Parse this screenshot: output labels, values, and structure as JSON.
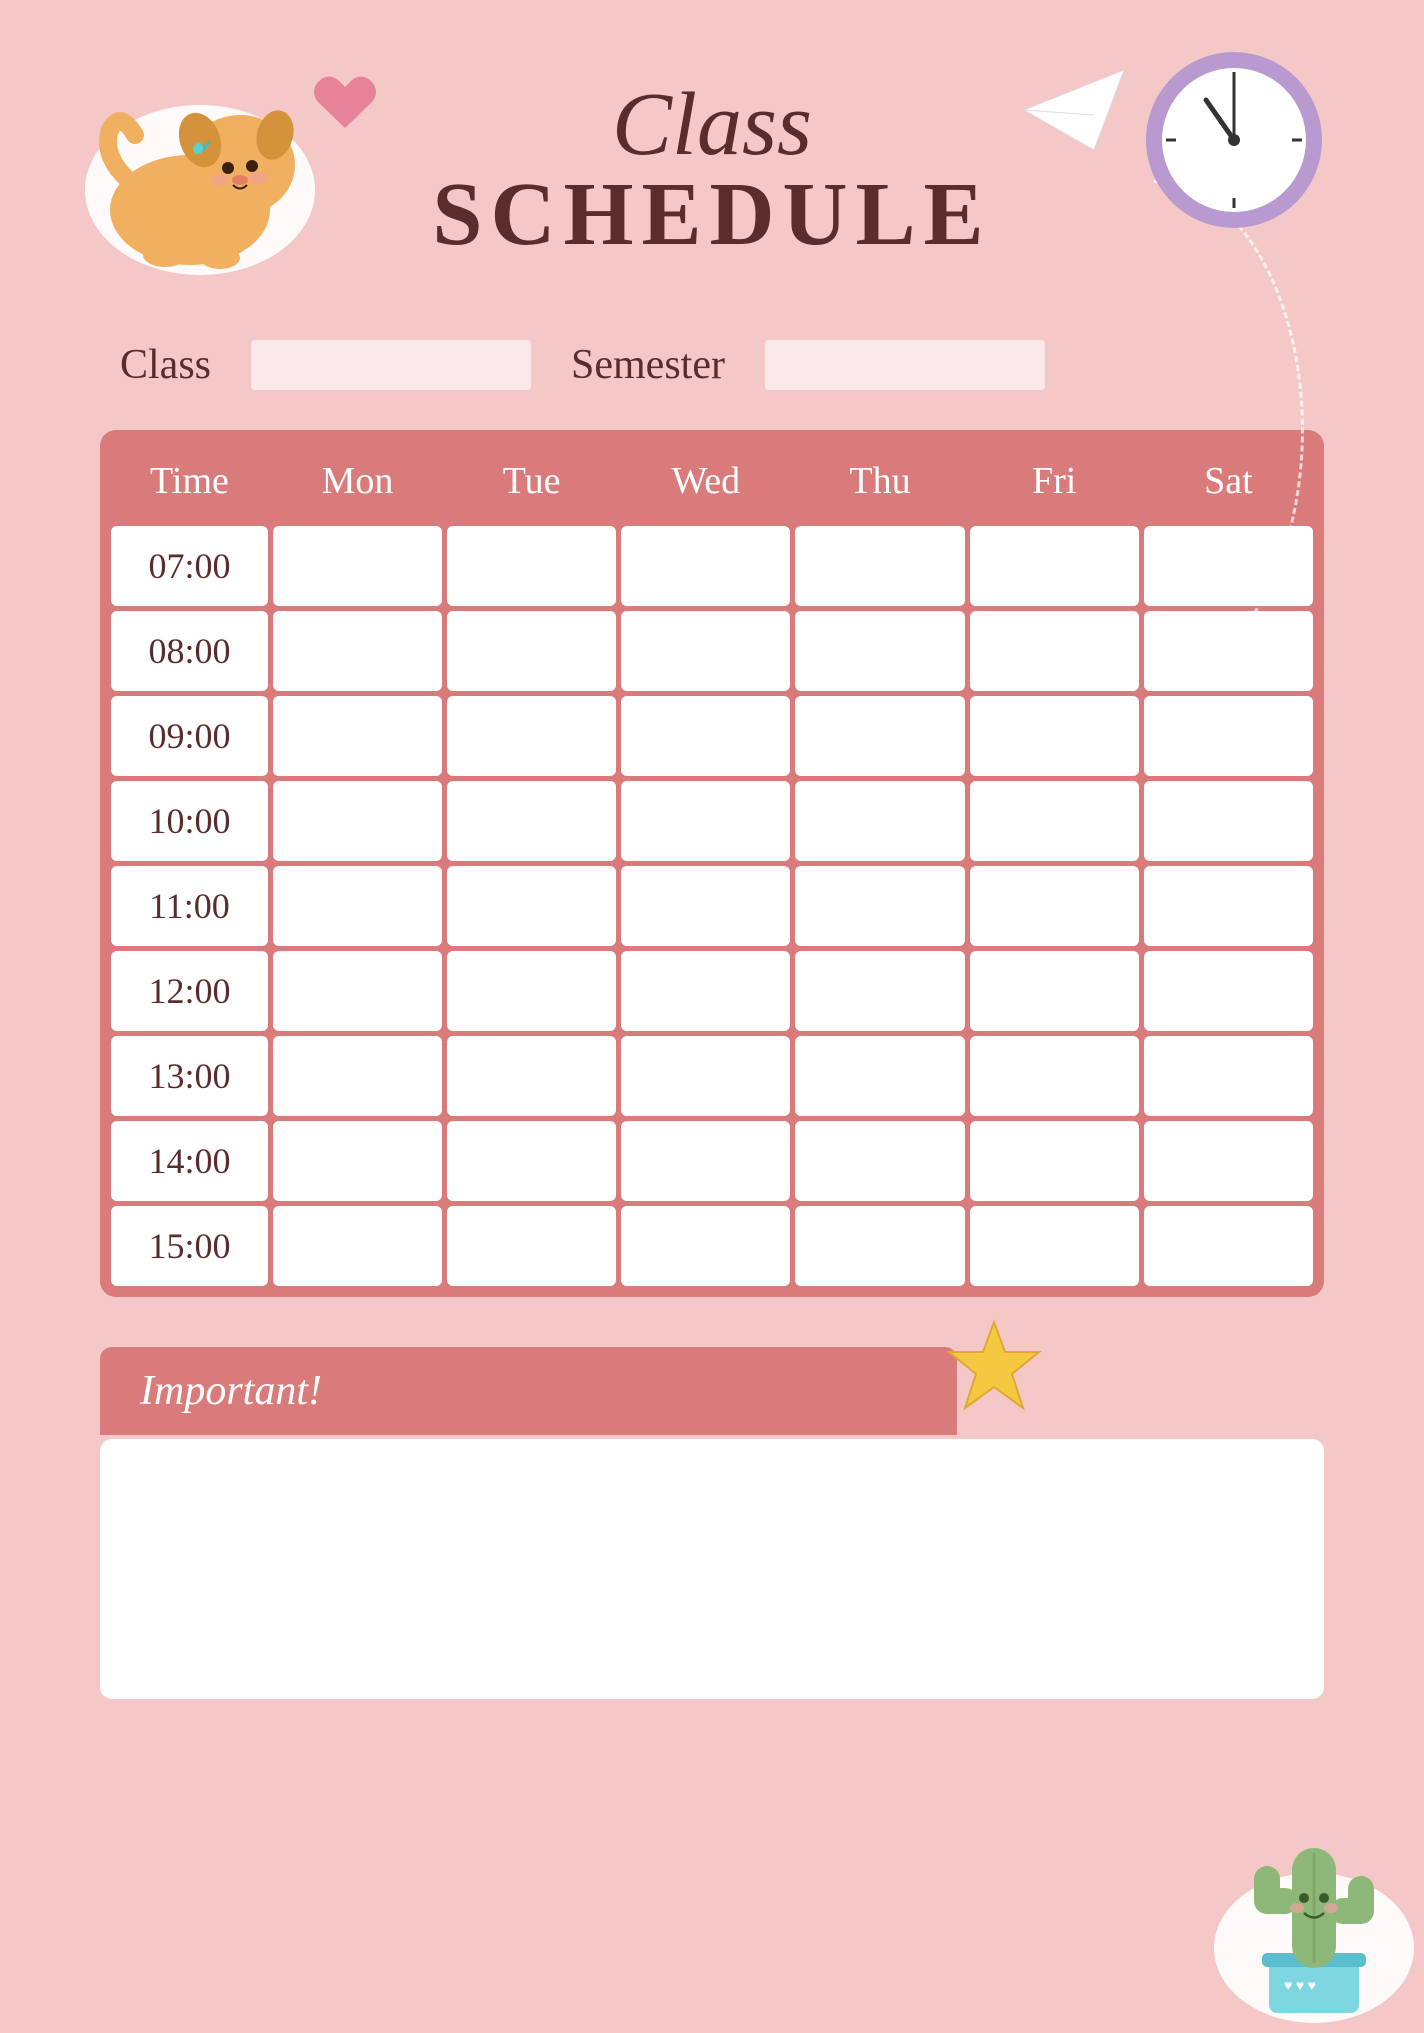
{
  "page": {
    "background_color": "#f5c8c8"
  },
  "header": {
    "title_line1": "Class",
    "title_line2": "SCHEDULE"
  },
  "form": {
    "class_label": "Class",
    "class_value": "",
    "semester_label": "Semester",
    "semester_value": ""
  },
  "table": {
    "headers": [
      "Time",
      "Mon",
      "Tue",
      "Wed",
      "Thu",
      "Fri",
      "Sat"
    ],
    "rows": [
      {
        "time": "07:00",
        "cells": [
          "",
          "",
          "",
          "",
          "",
          ""
        ]
      },
      {
        "time": "08:00",
        "cells": [
          "",
          "",
          "",
          "",
          "",
          ""
        ]
      },
      {
        "time": "09:00",
        "cells": [
          "",
          "",
          "",
          "",
          "",
          ""
        ]
      },
      {
        "time": "10:00",
        "cells": [
          "",
          "",
          "",
          "",
          "",
          ""
        ]
      },
      {
        "time": "11:00",
        "cells": [
          "",
          "",
          "",
          "",
          "",
          ""
        ]
      },
      {
        "time": "12:00",
        "cells": [
          "",
          "",
          "",
          "",
          "",
          ""
        ]
      },
      {
        "time": "13:00",
        "cells": [
          "",
          "",
          "",
          "",
          "",
          ""
        ]
      },
      {
        "time": "14:00",
        "cells": [
          "",
          "",
          "",
          "",
          "",
          ""
        ]
      },
      {
        "time": "15:00",
        "cells": [
          "",
          "",
          "",
          "",
          "",
          ""
        ]
      }
    ]
  },
  "important": {
    "label": "Important!",
    "content": ""
  },
  "decorations": {
    "heart_emoji": "♥",
    "star_color": "#f5c842"
  }
}
